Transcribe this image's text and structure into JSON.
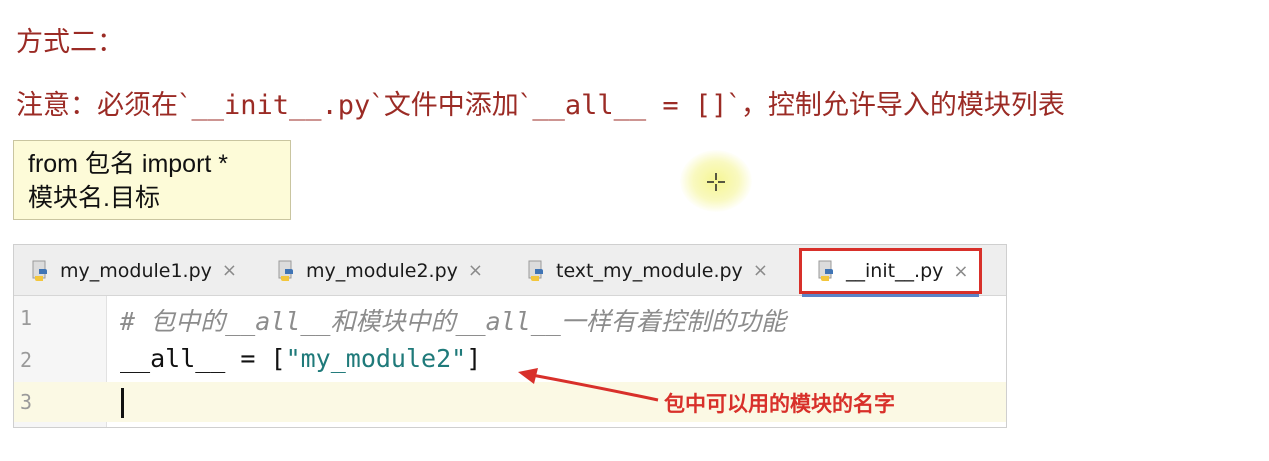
{
  "heading": "方式二：",
  "note": {
    "prefix": "注意：必须在`",
    "code1": "__init__.py",
    "middle": "`文件中添加`",
    "code2": "__all__ = []",
    "suffix": "`，控制允许导入的模块列表"
  },
  "snippet": {
    "line1": "from 包名 import *",
    "line2": "模块名.目标"
  },
  "tabs": [
    {
      "label": "my_module1.py",
      "icon": "python-file-icon",
      "close": "×"
    },
    {
      "label": "my_module2.py",
      "icon": "python-file-icon",
      "close": "×"
    },
    {
      "label": "text_my_module.py",
      "icon": "python-file-icon",
      "close": "×"
    },
    {
      "label": "__init__.py",
      "icon": "python-file-icon",
      "close": "×",
      "active": true
    }
  ],
  "code": {
    "lines": [
      {
        "num": "1",
        "comment": "# 包中的__all__和模块中的__all__一样有着控制的功能"
      },
      {
        "num": "2",
        "pre": "__all__ = [",
        "string": "\"my_module2\"",
        "post": "]"
      },
      {
        "num": "3"
      }
    ]
  },
  "annotation": "包中可以用的模块的名字",
  "colors": {
    "heading_text": "#9b2b25",
    "highlight_border": "#d8302a",
    "annotation": "#d8302a",
    "string": "#1f7a7a",
    "comment": "#8c8c8c",
    "snippet_bg": "#fdfbd8"
  }
}
